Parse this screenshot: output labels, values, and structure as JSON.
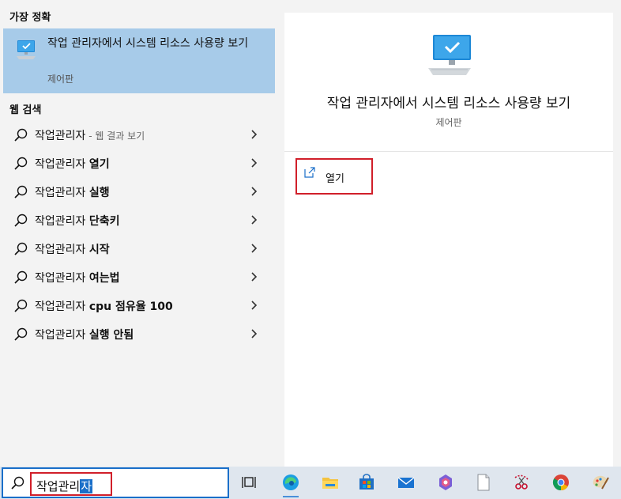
{
  "left_pane": {
    "best_match": {
      "section_label": "가장 정확",
      "title": "작업 관리자에서 시스템 리소스 사용량 보기",
      "subtitle": "제어판",
      "icon": "monitor-icon"
    },
    "web_search": {
      "section_label": "웹 검색",
      "items": [
        {
          "prefix": "작업관리자",
          "bold": "",
          "hint": " - 웹 결과 보기"
        },
        {
          "prefix": "작업관리자 ",
          "bold": "열기",
          "hint": ""
        },
        {
          "prefix": "작업관리자 ",
          "bold": "실행",
          "hint": ""
        },
        {
          "prefix": "작업관리자 ",
          "bold": "단축키",
          "hint": ""
        },
        {
          "prefix": "작업관리자 ",
          "bold": "시작",
          "hint": ""
        },
        {
          "prefix": "작업관리자 ",
          "bold": "여는법",
          "hint": ""
        },
        {
          "prefix": "작업관리자 ",
          "bold": "cpu 점유율 100",
          "hint": ""
        },
        {
          "prefix": "작업관리자 ",
          "bold": "실행 안됨",
          "hint": ""
        }
      ]
    }
  },
  "right_pane": {
    "title": "작업 관리자에서 시스템 리소스 사용량 보기",
    "subtitle": "제어판",
    "open_action": "열기"
  },
  "taskbar": {
    "search": {
      "typed": "작업관리",
      "selected": "자"
    },
    "apps": [
      "task-view-icon",
      "edge-icon",
      "file-explorer-icon",
      "store-icon",
      "mail-icon",
      "office-icon",
      "notepad-icon",
      "snipping-tool-icon",
      "chrome-icon",
      "paint-icon"
    ]
  },
  "colors": {
    "accent": "#1a6fc9",
    "selected_result": "#a7cbe9",
    "highlight_box": "#d11f2a"
  }
}
